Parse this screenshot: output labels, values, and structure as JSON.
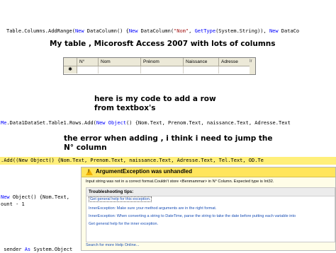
{
  "code_lines": {
    "line1": {
      "a": "Table.Columns.AddRange(",
      "b": "New",
      "c": " DataColumn() {",
      "d": "New",
      "e": " DataColumn(",
      "f": "\"Nom\"",
      "g": ", ",
      "h": "GetType",
      "i": "(System.String)), ",
      "j": "New",
      "k": " DataCo"
    },
    "line2": {
      "a": "Me",
      "b": ".Data1DataSet.Table1.Rows.Add(",
      "c": "New",
      "d": " ",
      "e": "Object",
      "f": "() {Nom.Text, Prenom.Text, naissance.Text, Adresse.Text"
    },
    "line3": {
      "a": ".Add(",
      "b": "(New Object() {Nom.Text, Prenom.Text, naissance.Text, Adresse.Text, Tel.Text, OD.Te"
    },
    "line4a": {
      "a": "New",
      "b": " Object() {Nom.Text,"
    },
    "line4b": "ount - 1",
    "line5": {
      "a": " sender ",
      "b": "As",
      "c": " System.Object"
    }
  },
  "captions": {
    "table_caption": "My table , Micorosft Access 2007 with lots of columns",
    "code_caption_1": "here is my code to add a row",
    "code_caption_2": "from textbox's",
    "error_caption_1": "the error when adding , i think i need to jump the",
    "error_caption_2": "N° column"
  },
  "access_table": {
    "columns": [
      "N°",
      "Nom",
      "Prénom",
      "Naissance",
      "Adresse"
    ],
    "new_row_marker": "✱",
    "side_fragment": "Ir"
  },
  "exception_dialog": {
    "title": "ArgumentException was unhandled",
    "message": "Input string was not in a correct format.Couldn't store <Benmammar> in N° Column.  Expected type is Int32.",
    "tips_header": "Troubleshooting tips:",
    "tips": [
      "Get general help for this exception.",
      "InnerException: Make sure your method arguments are in the right format.",
      "InnerException: When converting a string to DateTime, parse the string to take the date before putting each variable into",
      "Get general help for the inner exception."
    ],
    "search_link": "Search for more Help Online..."
  },
  "colors": {
    "highlight": "#ffef7a",
    "dialog_title": "#ffe55c",
    "link": "#1a4fb5",
    "keyword": "#0000ff"
  }
}
